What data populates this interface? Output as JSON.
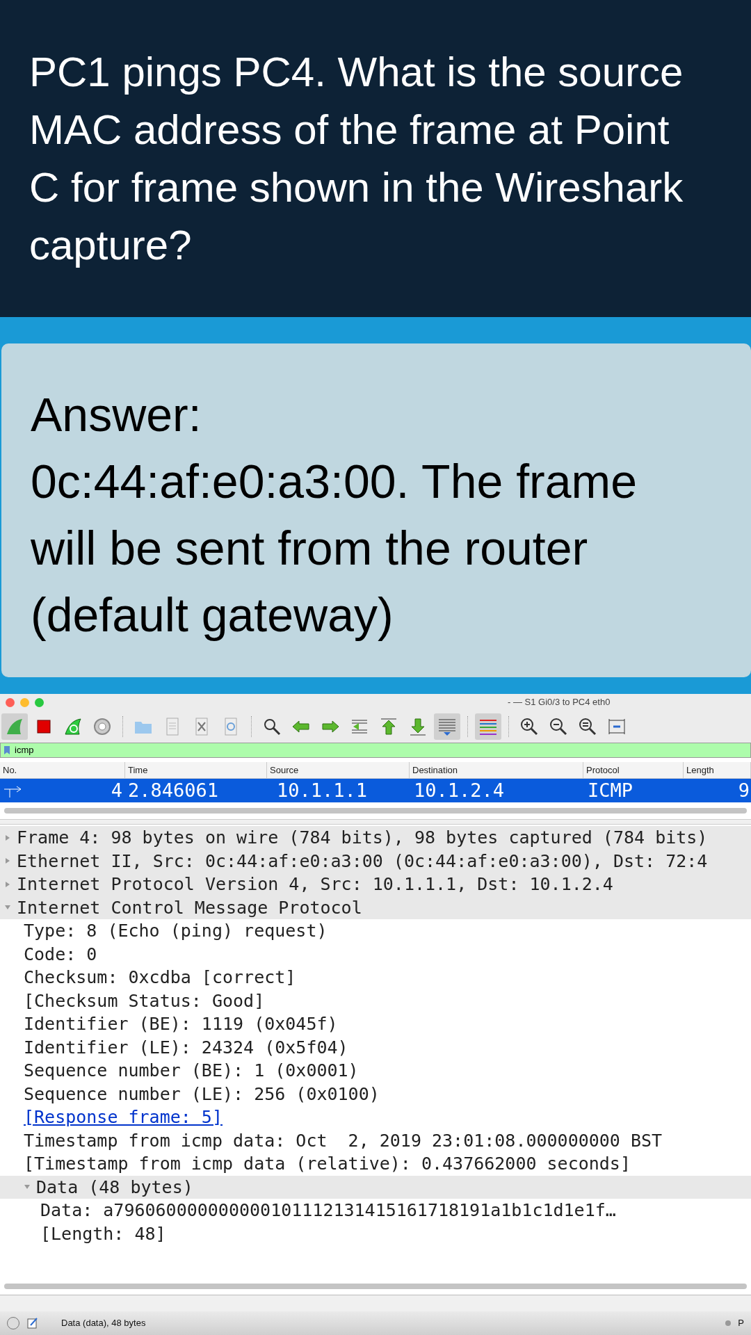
{
  "question": "PC1 pings PC4. What is the source MAC address of the frame at Point C for frame shown in the Wireshark capture?",
  "answer_label": "Answer:",
  "answer": "0c:44:af:e0:a3:00. The frame will be sent from the router (default gateway)",
  "window": {
    "title": "- — S1 Gi0/3 to PC4 eth0"
  },
  "filter": {
    "value": "icmp"
  },
  "packet_list": {
    "columns": [
      "No.",
      "Time",
      "Source",
      "Destination",
      "Protocol",
      "Length"
    ],
    "rows": [
      {
        "no": "4",
        "time": "2.846061",
        "source": "10.1.1.1",
        "destination": "10.1.2.4",
        "protocol": "ICMP",
        "length": "9",
        "selected": true
      }
    ]
  },
  "details": [
    {
      "text": "Frame 4: 98 bytes on wire (784 bits), 98 bytes captured (784 bits)",
      "expanded": false
    },
    {
      "text": "Ethernet II, Src: 0c:44:af:e0:a3:00 (0c:44:af:e0:a3:00), Dst: 72:4",
      "expanded": false
    },
    {
      "text": "Internet Protocol Version 4, Src: 10.1.1.1, Dst: 10.1.2.4",
      "expanded": false
    },
    {
      "text": "Internet Control Message Protocol",
      "expanded": true,
      "children": [
        {
          "text": "Type: 8 (Echo (ping) request)"
        },
        {
          "text": "Code: 0"
        },
        {
          "text": "Checksum: 0xcdba [correct]"
        },
        {
          "text": "[Checksum Status: Good]"
        },
        {
          "text": "Identifier (BE): 1119 (0x045f)"
        },
        {
          "text": "Identifier (LE): 24324 (0x5f04)"
        },
        {
          "text": "Sequence number (BE): 1 (0x0001)"
        },
        {
          "text": "Sequence number (LE): 256 (0x0100)"
        },
        {
          "text": "[Response frame: 5]",
          "kind": "link"
        },
        {
          "text": "Timestamp from icmp data: Oct  2, 2019 23:01:08.000000000 BST"
        },
        {
          "text": "[Timestamp from icmp data (relative): 0.437662000 seconds]"
        },
        {
          "text": "Data (48 bytes)",
          "expanded": true,
          "children": [
            {
              "text": "Data: a796060000000000101112131415161718191a1b1c1d1e1f…"
            },
            {
              "text": "[Length: 48]"
            }
          ]
        }
      ]
    }
  ],
  "status_bar": {
    "text": "Data (data), 48 bytes",
    "right": "P"
  }
}
